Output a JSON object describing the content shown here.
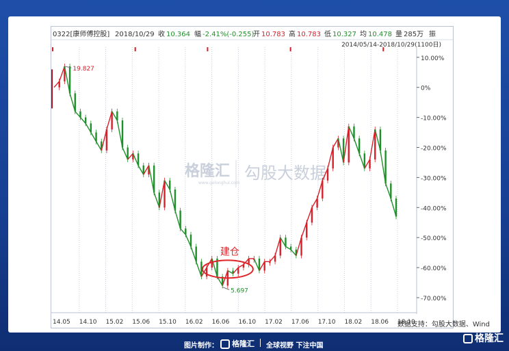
{
  "header": {
    "code_name": "0322[康师傅控股]",
    "date": "2018/10/29",
    "close_label": "收",
    "close_value": "10.364",
    "change_label": "幅",
    "change_value": "-2.41%(-0.255)",
    "open_label": "开",
    "open_value": "10.783",
    "high_label": "高",
    "high_value": "10.783",
    "low_label": "低",
    "low_value": "10.327",
    "avg_label": "均",
    "avg_value": "10.478",
    "volume_label": "量",
    "volume_value": "285万",
    "amplitude_label": "振",
    "range": "2014/05/14-2018/10/29(1100日)"
  },
  "annotations": {
    "high_value": "19.827",
    "low_value": "5.697",
    "entry_label": "建仓"
  },
  "watermark": {
    "brand": "格隆汇",
    "sub": "www.gelonghui.com",
    "text": "勾股大数据"
  },
  "source_note": "数据支持：勾股大数据、Wind",
  "footer": {
    "credit_label": "图片制作：",
    "brand": "格隆汇",
    "slogan": "全球视野 下注中国",
    "corner_brand": "格隆汇"
  },
  "colors": {
    "up": "#d6202a",
    "down": "#1f8f2a",
    "axis": "#b9c3d3",
    "highlight": "#e0262b"
  },
  "chart_data": {
    "type": "line",
    "title": "",
    "xlabel": "",
    "ylabel": "",
    "x_ticks": [
      "14.05",
      "14.10",
      "15.02",
      "15.06",
      "15.10",
      "16.02",
      "16.06",
      "16.10",
      "17.02",
      "17.06",
      "17.10",
      "18.02",
      "18.06",
      "18.10"
    ],
    "y_ticks": [
      "10.00%",
      "0%",
      "-10.00%",
      "-20.00%",
      "-30.00%",
      "-40.00%",
      "-50.00%",
      "-60.00%",
      "-70.00%"
    ],
    "ylim": [
      -75,
      12
    ],
    "series": [
      {
        "values": [
          0,
          2,
          7,
          -2,
          -8,
          -10,
          -12,
          -15,
          -18,
          -21,
          -14,
          -8,
          -11,
          -20,
          -24,
          -22,
          -26,
          -29,
          -26,
          -35,
          -40,
          -31,
          -34,
          -41,
          -47,
          -49,
          -53,
          -58,
          -63,
          -60,
          -57,
          -63,
          -66,
          -61,
          -62,
          -60,
          -59,
          -57,
          -57,
          -61,
          -58,
          -58,
          -56,
          -50,
          -53,
          -54,
          -56,
          -50,
          -45,
          -40,
          -37,
          -31,
          -27,
          -20,
          -17,
          -25,
          -13,
          -17,
          -22,
          -27,
          -24,
          -14,
          -21,
          -32,
          -37,
          -43
        ]
      }
    ],
    "max_marker": {
      "index": 2,
      "value": 19.827
    },
    "min_marker": {
      "index": 32,
      "value": 5.697
    }
  }
}
